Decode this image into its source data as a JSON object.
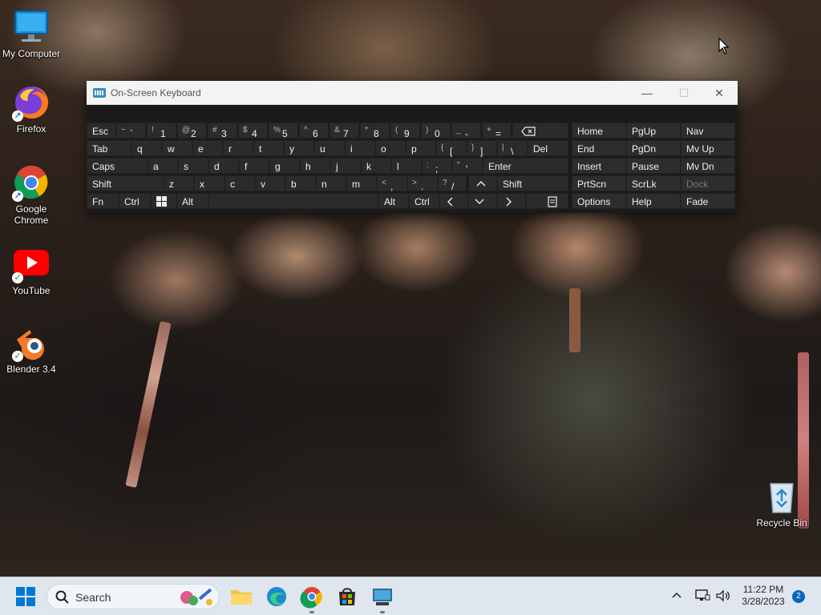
{
  "desktop": {
    "icons": [
      {
        "label": "My Computer"
      },
      {
        "label": "Firefox"
      },
      {
        "label": "Google Chrome"
      },
      {
        "label": "YouTube"
      },
      {
        "label": "Blender 3.4"
      },
      {
        "label": "Recycle Bin"
      }
    ]
  },
  "osk": {
    "title": "On-Screen Keyboard",
    "row1": [
      {
        "main": "Esc"
      },
      {
        "sym": "~",
        "main": "`"
      },
      {
        "sym": "!",
        "main": "1"
      },
      {
        "sym": "@",
        "main": "2"
      },
      {
        "sym": "#",
        "main": "3"
      },
      {
        "sym": "$",
        "main": "4"
      },
      {
        "sym": "%",
        "main": "5"
      },
      {
        "sym": "^",
        "main": "6"
      },
      {
        "sym": "&",
        "main": "7"
      },
      {
        "sym": "*",
        "main": "8"
      },
      {
        "sym": "(",
        "main": "9"
      },
      {
        "sym": ")",
        "main": "0"
      },
      {
        "sym": "_",
        "main": "-"
      },
      {
        "sym": "+",
        "main": "="
      }
    ],
    "row2": [
      {
        "main": "Tab"
      },
      {
        "main": "q"
      },
      {
        "main": "w"
      },
      {
        "main": "e"
      },
      {
        "main": "r"
      },
      {
        "main": "t"
      },
      {
        "main": "y"
      },
      {
        "main": "u"
      },
      {
        "main": "i"
      },
      {
        "main": "o"
      },
      {
        "main": "p"
      },
      {
        "sym": "{",
        "main": "["
      },
      {
        "sym": "}",
        "main": "]"
      },
      {
        "sym": "|",
        "main": "\\"
      },
      {
        "main": "Del"
      }
    ],
    "row3": [
      {
        "main": "Caps"
      },
      {
        "main": "a"
      },
      {
        "main": "s"
      },
      {
        "main": "d"
      },
      {
        "main": "f"
      },
      {
        "main": "g"
      },
      {
        "main": "h"
      },
      {
        "main": "j"
      },
      {
        "main": "k"
      },
      {
        "main": "l"
      },
      {
        "sym": ":",
        "main": ";"
      },
      {
        "sym": "\"",
        "main": "'"
      },
      {
        "main": "Enter"
      }
    ],
    "row4": [
      {
        "main": "Shift"
      },
      {
        "main": "z"
      },
      {
        "main": "x"
      },
      {
        "main": "c"
      },
      {
        "main": "v"
      },
      {
        "main": "b"
      },
      {
        "main": "n"
      },
      {
        "main": "m"
      },
      {
        "sym": "<",
        "main": ","
      },
      {
        "sym": ">",
        "main": "."
      },
      {
        "sym": "?",
        "main": "/"
      },
      {
        "main": "Shift"
      }
    ],
    "row5": [
      {
        "main": "Fn"
      },
      {
        "main": "Ctrl"
      },
      {
        "main": "Alt"
      },
      {
        "main": "Alt"
      },
      {
        "main": "Ctrl"
      }
    ],
    "nav": [
      [
        "Home",
        "PgUp",
        "Nav"
      ],
      [
        "End",
        "PgDn",
        "Mv Up"
      ],
      [
        "Insert",
        "Pause",
        "Mv Dn"
      ],
      [
        "PrtScn",
        "ScrLk",
        "Dock"
      ],
      [
        "Options",
        "Help",
        "Fade"
      ]
    ]
  },
  "taskbar": {
    "search_label": "Search",
    "time": "11:22 PM",
    "date": "3/28/2023",
    "notification_count": "2"
  },
  "colors": {
    "taskbar_bg": "#dfe6ee",
    "osk_bg": "#1f1f1f",
    "key_bg": "#2b2b2b",
    "accent": "#0067c0"
  }
}
